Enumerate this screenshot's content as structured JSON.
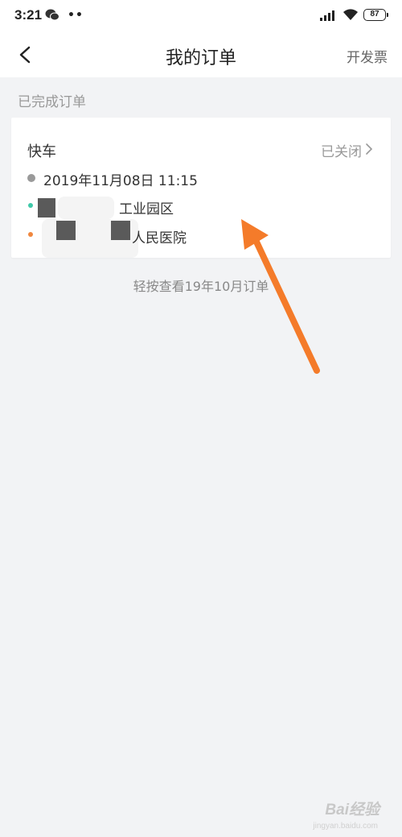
{
  "status_bar": {
    "time": "3:21",
    "battery": "87"
  },
  "nav": {
    "title": "我的订单",
    "invoice_label": "开发票"
  },
  "section": {
    "label": "已完成订单"
  },
  "order": {
    "type": "快车",
    "status": "已关闭",
    "time": "2019年11月08日 11:15",
    "start_address": "工业园区",
    "end_address": "人民医院",
    "start_color": "#40c9a9",
    "end_color": "#f0873f"
  },
  "history_link": "轻按查看19年10月订单",
  "watermark": {
    "brand": "Bai经验",
    "sub": "jingyan.baidu.com"
  },
  "colors": {
    "arrow": "#f47b2a",
    "background": "#f2f3f5"
  }
}
